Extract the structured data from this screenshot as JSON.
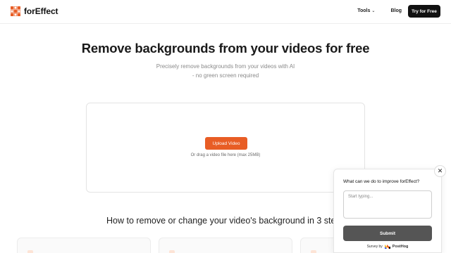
{
  "header": {
    "logo_text": "forEffect",
    "logo_icon": "grid-x-icon",
    "nav": [
      {
        "label": "Tools",
        "icon": "chevron-down-icon"
      },
      {
        "label": "Blog"
      }
    ],
    "cta_label": "Try for Free"
  },
  "hero": {
    "title": "Remove backgrounds from your videos for free",
    "subtitle_line1": "Precisely remove backgrounds from your videos with AI",
    "subtitle_line2": "- no green screen required"
  },
  "upload": {
    "button_label": "Upload Video",
    "hint": "Or drag a video file here (max 25MB)"
  },
  "how": {
    "title": "How to remove or change your video's background in 3 ste"
  },
  "survey": {
    "question": "What can we do to improve forEffect?",
    "placeholder": "Start typing...",
    "submit_label": "Submit",
    "footer_prefix": "Survey by",
    "footer_brand": "PostHog",
    "close_icon": "close-icon"
  },
  "colors": {
    "accent": "#e85d25",
    "dark": "#111111",
    "submit_bg": "#555555"
  }
}
